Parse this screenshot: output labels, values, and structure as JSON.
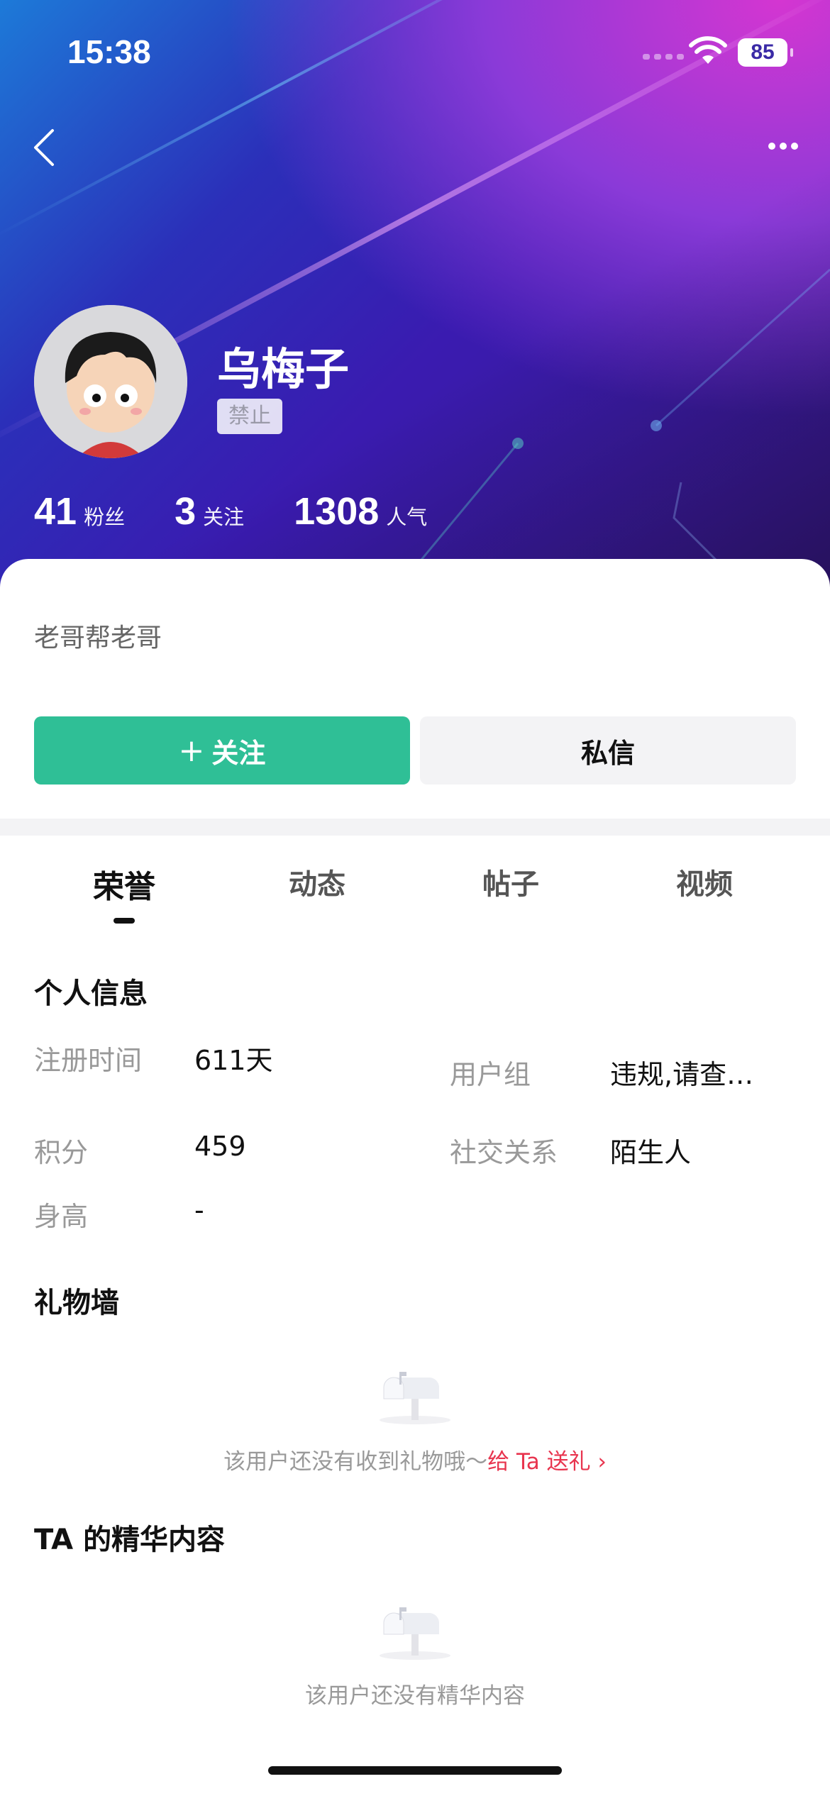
{
  "status_bar": {
    "time": "15:38",
    "battery": "85"
  },
  "profile": {
    "name": "乌梅子",
    "badge": "禁止",
    "stats": [
      {
        "num": "41",
        "label": "粉丝"
      },
      {
        "num": "3",
        "label": "关注"
      },
      {
        "num": "1308",
        "label": "人气"
      }
    ],
    "bio": "老哥帮老哥"
  },
  "actions": {
    "follow": "关注",
    "follow_prefix": "+",
    "message": "私信"
  },
  "tabs": [
    {
      "label": "荣誉",
      "active": true
    },
    {
      "label": "动态",
      "active": false
    },
    {
      "label": "帖子",
      "active": false
    },
    {
      "label": "视频",
      "active": false
    }
  ],
  "personal_info": {
    "title": "个人信息",
    "fields": [
      {
        "label": "注册时间",
        "value": "611天"
      },
      {
        "label": "用户组",
        "value": "违规,请查…"
      },
      {
        "label": "积分",
        "value": "459"
      },
      {
        "label": "社交关系",
        "value": "陌生人"
      },
      {
        "label": "身高",
        "value": "-"
      }
    ]
  },
  "gift_wall": {
    "title": "礼物墙",
    "empty_text": "该用户还没有收到礼物哦～",
    "link_text": "给 Ta 送礼"
  },
  "featured": {
    "title": "TA 的精华内容",
    "empty_text": "该用户还没有精华内容"
  },
  "colors": {
    "accent": "#2fbf96",
    "link": "#e8344e"
  }
}
